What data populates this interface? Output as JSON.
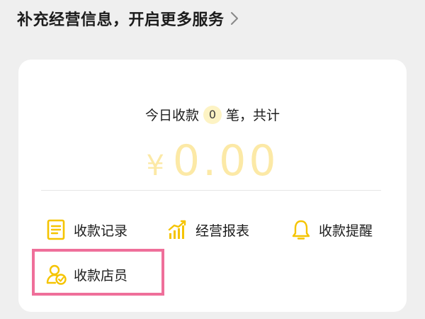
{
  "header": {
    "title": "补充经营信息，开启更多服务",
    "chevron_icon": "chevron-right-icon"
  },
  "summary": {
    "prefix": "今日收款",
    "count": "0",
    "suffix": "笔，共计"
  },
  "amount": {
    "currency_symbol": "¥",
    "value": "0.00"
  },
  "actions": [
    {
      "label": "收款记录",
      "icon": "document-icon"
    },
    {
      "label": "经营报表",
      "icon": "chart-icon"
    },
    {
      "label": "收款提醒",
      "icon": "bell-icon"
    },
    {
      "label": "收款店员",
      "icon": "staff-icon"
    }
  ],
  "colors": {
    "accent": "#f5c400",
    "amount": "#fce9a6",
    "badge_bg": "#fdf3c4",
    "highlight": "#ef6f9a",
    "background": "#efefef"
  }
}
